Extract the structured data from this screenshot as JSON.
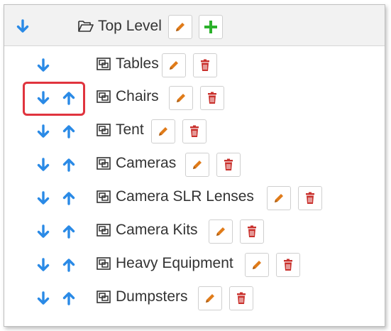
{
  "root": {
    "label": "Top Level"
  },
  "nodes": [
    {
      "label": "Tables"
    },
    {
      "label": "Chairs"
    },
    {
      "label": "Tent"
    },
    {
      "label": "Cameras"
    },
    {
      "label": "Camera SLR Lenses"
    },
    {
      "label": "Camera Kits"
    },
    {
      "label": "Heavy Equipment"
    },
    {
      "label": "Dumpsters"
    }
  ],
  "icons": {
    "move_down": "arrow-down-icon",
    "move_up": "arrow-up-icon",
    "edit": "pencil-icon",
    "delete": "trash-icon",
    "add": "plus-icon",
    "folder": "folder-open-icon",
    "node": "category-node-icon"
  },
  "colors": {
    "arrow": "#2a8ae6",
    "edit": "#e07b19",
    "delete": "#c9302c",
    "add": "#2bb12b",
    "highlight": "#e0343e",
    "header_bg": "#f2f2f2"
  }
}
